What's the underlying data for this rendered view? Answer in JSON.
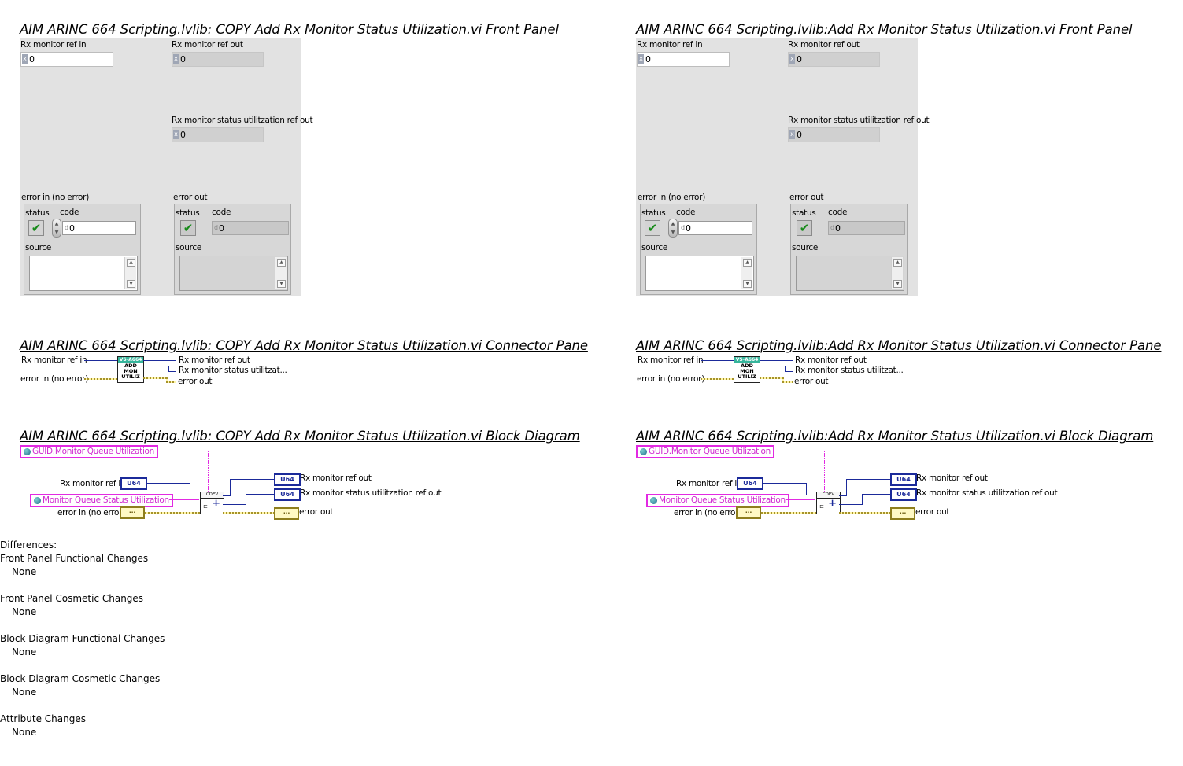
{
  "left": {
    "fp_title": "AIM ARINC 664 Scripting.lvlib:  COPY  Add Rx Monitor Status Utilization.vi Front Panel",
    "cp_title": "AIM ARINC 664 Scripting.lvlib:  COPY  Add Rx Monitor Status Utilization.vi Connector Pane",
    "bd_title": "AIM ARINC 664 Scripting.lvlib:  COPY  Add Rx Monitor Status Utilization.vi Block Diagram"
  },
  "right": {
    "fp_title": "AIM ARINC 664 Scripting.lvlib:Add Rx Monitor Status Utilization.vi Front Panel",
    "cp_title": "AIM ARINC 664 Scripting.lvlib:Add Rx Monitor Status Utilization.vi Connector Pane",
    "bd_title": "AIM ARINC 664 Scripting.lvlib:Add Rx Monitor Status Utilization.vi Block Diagram"
  },
  "front_panel": {
    "rx_in_label": "Rx monitor ref in",
    "rx_out_label": "Rx monitor ref out",
    "status_out_label": "Rx monitor status utilitzation ref out",
    "num_value": "0",
    "radix": "x",
    "error_in_label": "error in (no error)",
    "error_out_label": "error out",
    "status_label": "status",
    "code_label": "code",
    "code_radix": "d",
    "code_value": "0",
    "source_label": "source",
    "check_glyph": "✔"
  },
  "connector_pane": {
    "rx_in": "Rx monitor ref in",
    "error_in": "error in (no error)",
    "rx_out": "Rx monitor ref out",
    "status_out": "Rx monitor status utilitzat...",
    "error_out": "error out",
    "icon_top": "VS-A664",
    "icon_line1": "ADD",
    "icon_line2": "MON",
    "icon_line3": "UTILIZ"
  },
  "block_diagram": {
    "guid_const": "GUID.Monitor Queue Utilization",
    "queue_const": "Monitor Queue Status Utilization",
    "rx_in": "Rx monitor ref in",
    "error_in": "error in (no error)",
    "rx_out": "Rx monitor ref out",
    "status_out": "Rx monitor status utilitzation ref out",
    "error_out": "error out",
    "u64": "U64",
    "node_label": "CDEV",
    "err_glyph": "⋯"
  },
  "differences": {
    "heading": "Differences:",
    "items": [
      {
        "category": "Front Panel Functional Changes",
        "value": "None"
      },
      {
        "category": "Front Panel Cosmetic Changes",
        "value": "None"
      },
      {
        "category": "Block Diagram Functional Changes",
        "value": "None"
      },
      {
        "category": "Block Diagram Cosmetic Changes",
        "value": "None"
      },
      {
        "category": "Attribute Changes",
        "value": "None"
      }
    ]
  },
  "colors": {
    "refnum_wire": "#1b2a9a",
    "class_wire": "#e22ae2",
    "error_wire": "#a5922b",
    "panel_bg": "#e2e2e2"
  }
}
